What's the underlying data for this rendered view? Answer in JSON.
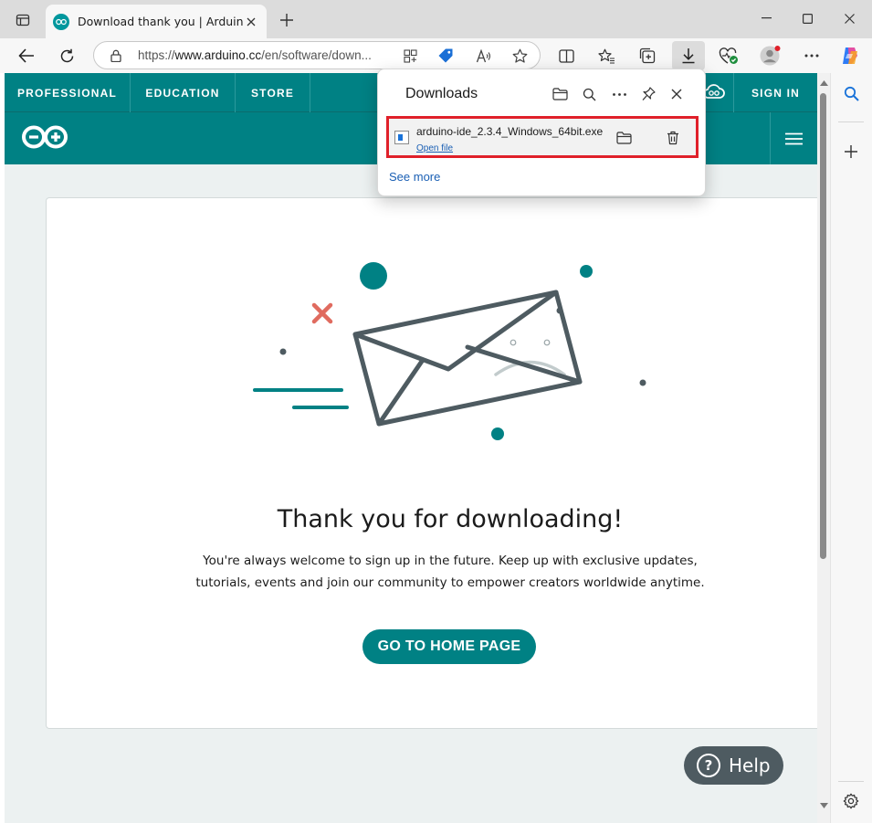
{
  "browser": {
    "tab": {
      "title": "Download thank you | Arduino",
      "favicon": "arduino-favicon"
    },
    "url": {
      "scheme": "https://",
      "host": "www.arduino.cc",
      "path": "/en/software/down..."
    },
    "toolbar_icons": [
      "back-icon",
      "refresh-icon",
      "lock-icon",
      "app-available-icon",
      "coupon-icon",
      "read-aloud-icon",
      "favorite-star-icon",
      "split-screen-icon",
      "favorites-icon",
      "collections-icon",
      "downloads-icon",
      "browser-essentials-icon",
      "profile-icon",
      "more-icon",
      "copilot-icon"
    ],
    "window_controls": [
      "minimize-icon",
      "maximize-icon",
      "close-icon"
    ]
  },
  "downloads_panel": {
    "title": "Downloads",
    "item": {
      "filename": "arduino-ide_2.3.4_Windows_64bit.exe",
      "open_link": "Open file"
    },
    "see_more": "See more"
  },
  "site": {
    "topnav": [
      "PROFESSIONAL",
      "EDUCATION",
      "STORE"
    ],
    "sign_in": "SIGN IN",
    "colors": {
      "brand": "#008184",
      "accent_x": "#e06b5f",
      "help_bg": "#4e5b61"
    }
  },
  "content": {
    "heading": "Thank you for downloading!",
    "body": "You're always welcome to sign up in the future. Keep up with exclusive updates, tutorials, events and join our community to empower creators worldwide anytime.",
    "button": "GO TO HOME PAGE"
  },
  "help": {
    "label": "Help"
  }
}
